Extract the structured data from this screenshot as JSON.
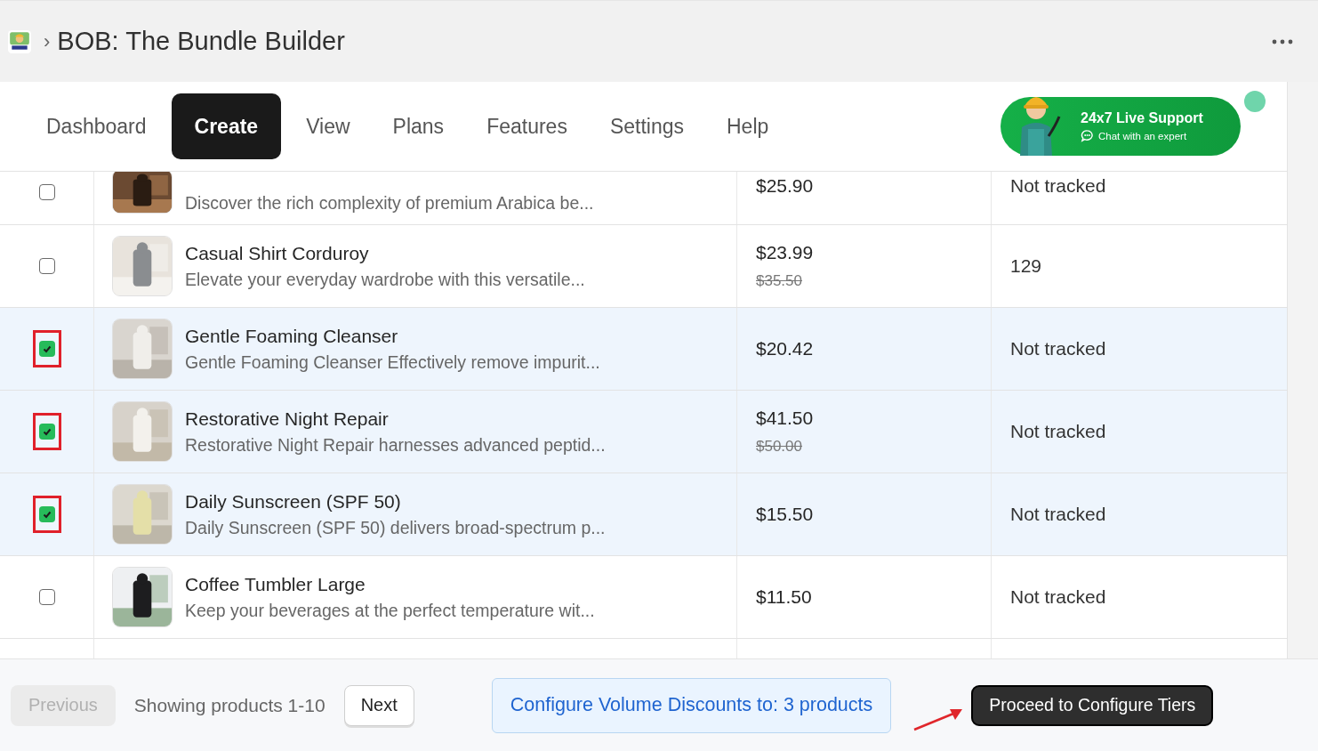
{
  "header": {
    "title": "BOB: The Bundle Builder",
    "breadcrumb_separator": "›"
  },
  "tabs": [
    {
      "label": "Dashboard",
      "selected": false
    },
    {
      "label": "Create",
      "selected": true
    },
    {
      "label": "View",
      "selected": false
    },
    {
      "label": "Plans",
      "selected": false
    },
    {
      "label": "Features",
      "selected": false
    },
    {
      "label": "Settings",
      "selected": false
    },
    {
      "label": "Help",
      "selected": false
    }
  ],
  "support": {
    "title": "24x7 Live Support",
    "subtitle": "Chat with an expert",
    "online": true
  },
  "products": [
    {
      "description": "Discover the rich complexity of premium Arabica be...",
      "price": "$25.90",
      "stock": "Not tracked",
      "checked": false,
      "annotated": false
    },
    {
      "title": "Casual Shirt Corduroy",
      "description": "Elevate your everyday wardrobe with this versatile...",
      "price": "$23.99",
      "compare_price": "$35.50",
      "stock": "129",
      "checked": false,
      "annotated": false
    },
    {
      "title": "Gentle Foaming Cleanser",
      "description": "Gentle Foaming Cleanser Effectively remove impurit...",
      "price": "$20.42",
      "stock": "Not tracked",
      "checked": true,
      "annotated": true
    },
    {
      "title": "Restorative Night Repair",
      "description": "Restorative Night Repair harnesses advanced peptid...",
      "price": "$41.50",
      "compare_price": "$50.00",
      "stock": "Not tracked",
      "checked": true,
      "annotated": true
    },
    {
      "title": "Daily Sunscreen (SPF 50)",
      "description": "Daily Sunscreen (SPF 50) delivers broad-spectrum p...",
      "price": "$15.50",
      "stock": "Not tracked",
      "checked": true,
      "annotated": true
    },
    {
      "title": "Coffee Tumbler Large",
      "description": "Keep your beverages at the perfect temperature wit...",
      "price": "$11.50",
      "stock": "Not tracked",
      "checked": false,
      "annotated": false
    }
  ],
  "footer": {
    "previous": {
      "label": "Previous",
      "disabled": true
    },
    "showing": "Showing products 1-10",
    "next": {
      "label": "Next",
      "disabled": false
    },
    "configure": "Configure Volume Discounts to: 3 products",
    "proceed": "Proceed to Configure Tiers"
  }
}
